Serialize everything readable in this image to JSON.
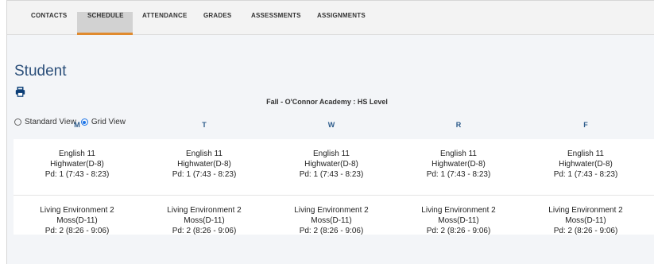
{
  "tabs": [
    {
      "label": "CONTACTS",
      "active": false
    },
    {
      "label": "SCHEDULE",
      "active": true
    },
    {
      "label": "ATTENDANCE",
      "active": false
    },
    {
      "label": "GRADES",
      "active": false
    },
    {
      "label": "ASSESSMENTS",
      "active": false
    },
    {
      "label": "ASSIGNMENTS",
      "active": false
    }
  ],
  "page": {
    "title": "Student",
    "print_icon": "printer-icon"
  },
  "views": {
    "standard_label": "Standard View",
    "grid_label": "Grid View",
    "selected": "Grid View"
  },
  "term": "Fall - O'Connor Academy : HS Level",
  "days": [
    "M",
    "T",
    "W",
    "R",
    "F"
  ],
  "schedule": [
    {
      "course": "English 11",
      "teacher": "Highwater(D-8)",
      "period": "Pd: 1 (7:43 - 8:23)"
    },
    {
      "course": "Living Environment 2",
      "teacher": "Moss(D-11)",
      "period": "Pd: 2 (8:26 - 9:06)"
    }
  ],
  "colors": {
    "accent": "#e08a2e",
    "title": "#2b4f7a",
    "day_header": "#2b5a8a",
    "radio_checked": "#1a73e8"
  }
}
